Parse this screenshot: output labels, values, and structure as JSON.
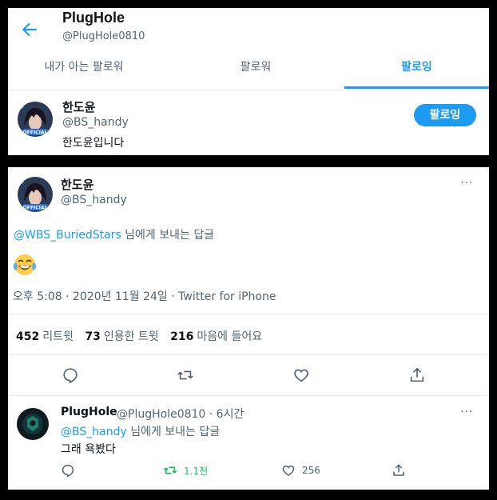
{
  "profile": {
    "name": "PlugHole",
    "handle": "@PlugHole0810"
  },
  "tabs": [
    "내가 아는 팔로워",
    "팔로워",
    "팔로잉"
  ],
  "active_tab": "팔로잉",
  "following_user": {
    "name": "한도윤",
    "handle": "@BS_handy",
    "bio": "한도윤입니다",
    "button": "팔로잉"
  },
  "tweet": {
    "name": "한도윤",
    "handle": "@BS_handy",
    "reply_to_mention": "@WBS_BuriedStars",
    "reply_to_suffix": "님에게 보내는 답글",
    "emoji": "face-with-tears-of-joy",
    "meta": "오후 5:08 · 2020년 11월 24일 · Twitter for iPhone",
    "stats": [
      {
        "count": "452",
        "label": "리트윗"
      },
      {
        "count": "73",
        "label": "인용한 트윗"
      },
      {
        "count": "216",
        "label": "마음에 들어요"
      }
    ],
    "more": "···"
  },
  "reply": {
    "name": "PlugHole",
    "handle_time": "@PlugHole0810 · 6시간",
    "reply_to_mention": "@BS_handy",
    "reply_to_suffix": "님에게 보내는 답글",
    "text": "그래 욕봤다",
    "retweets": "1.1천",
    "likes": "256",
    "more": "···"
  },
  "colors": {
    "accent": "#1d9bf0",
    "retweet_green": "#17bf63",
    "muted": "#536471"
  }
}
